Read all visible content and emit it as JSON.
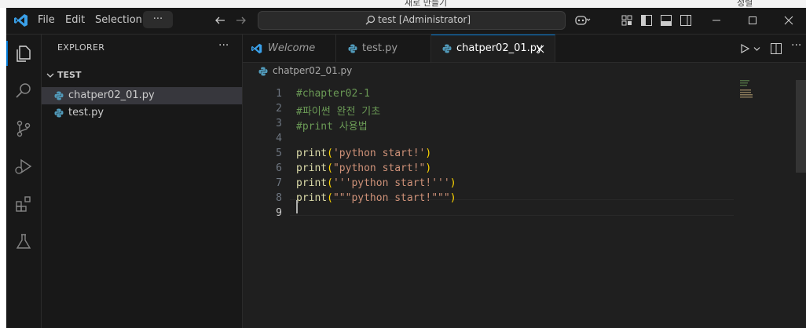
{
  "topbar_fragments": [
    "새로 만들기",
    "정렬"
  ],
  "menu": {
    "file": "File",
    "edit": "Edit",
    "selection": "Selection",
    "more": "···"
  },
  "command_center": {
    "label": "test [Administrator]"
  },
  "sidebar": {
    "title": "EXPLORER",
    "more": "···",
    "folder": "TEST",
    "files": [
      {
        "name": "chatper02_01.py",
        "selected": true
      },
      {
        "name": "test.py",
        "selected": false
      }
    ]
  },
  "tabs": [
    {
      "label": "Welcome",
      "active": false
    },
    {
      "label": "test.py",
      "active": false
    },
    {
      "label": "chatper02_01.py",
      "active": true
    }
  ],
  "breadcrumb": "chatper02_01.py",
  "editor": {
    "line_numbers": [
      "1",
      "2",
      "3",
      "4",
      "5",
      "6",
      "7",
      "8",
      "9"
    ],
    "current_line": "9",
    "lines": [
      {
        "kind": "comment",
        "text": "#chapter02-1"
      },
      {
        "kind": "comment",
        "text": "#파이썬 완전 기초"
      },
      {
        "kind": "comment",
        "text": "#print 사용법"
      },
      {
        "kind": "blank",
        "text": ""
      },
      {
        "kind": "call",
        "fn": "print",
        "open": "(",
        "arg": "'python start!'",
        "close": ")"
      },
      {
        "kind": "call",
        "fn": "print",
        "open": "(",
        "arg": "\"python start!\"",
        "close": ")"
      },
      {
        "kind": "call",
        "fn": "print",
        "open": "(",
        "arg": "'''python start!'''",
        "close": ")"
      },
      {
        "kind": "call",
        "fn": "print",
        "open": "(",
        "arg": "\"\"\"python start!\"\"\"",
        "close": ")"
      },
      {
        "kind": "blank",
        "text": ""
      }
    ]
  },
  "colors": {
    "accent": "#0078d4",
    "comment": "#6a9955",
    "function": "#dcdcaa",
    "string": "#ce9178",
    "bracket": "#ffd700",
    "python_icon": "#519aba"
  }
}
